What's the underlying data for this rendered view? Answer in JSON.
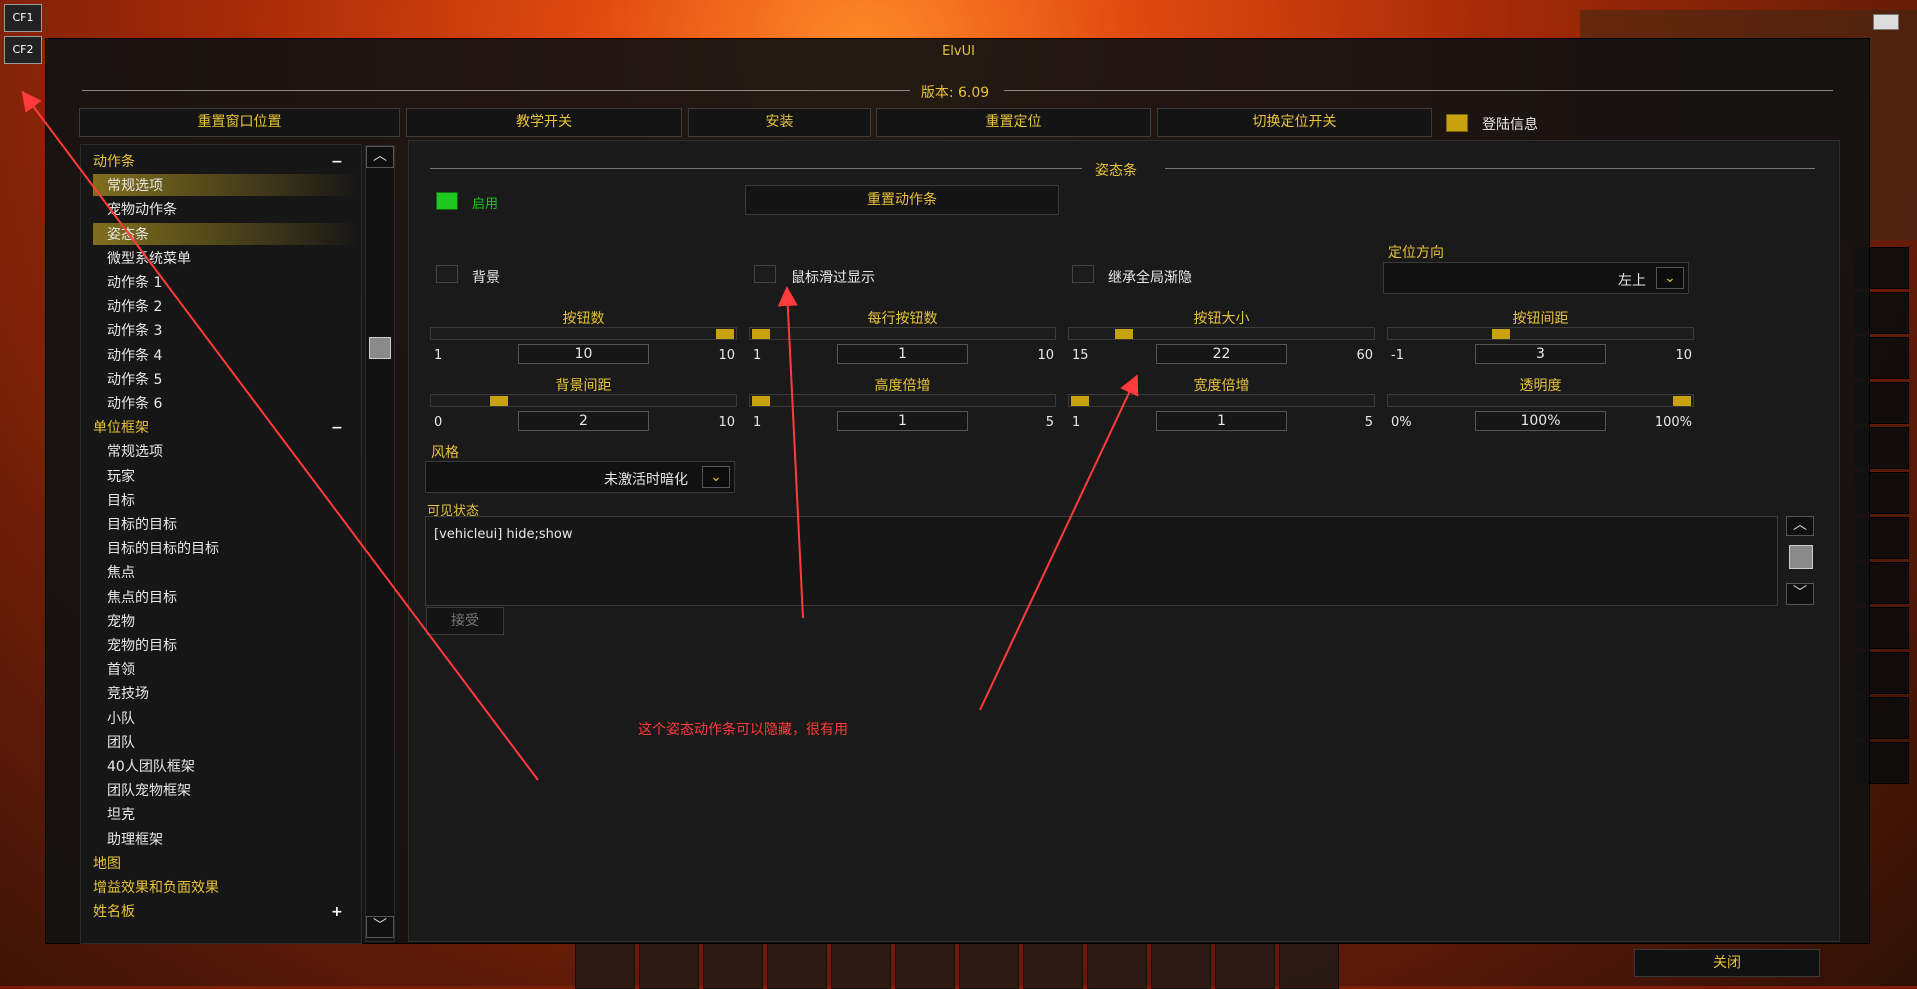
{
  "window_title": "ElvUI",
  "version_label": "版本:",
  "version_value": "6.09",
  "corner": {
    "cf1": "CF1",
    "cf2": "CF2"
  },
  "top_buttons": [
    "重置窗口位置",
    "教学开关",
    "安装",
    "重置定位",
    "切换定位开关"
  ],
  "login_info": {
    "label": "登陆信息",
    "checked": true
  },
  "sidebar": [
    {
      "label": "动作条",
      "type": "category",
      "toggle": "−"
    },
    {
      "label": "常规选项",
      "type": "item",
      "selected": true
    },
    {
      "label": "宠物动作条",
      "type": "item"
    },
    {
      "label": "姿态条",
      "type": "item",
      "selected": true
    },
    {
      "label": "微型系统菜单",
      "type": "item"
    },
    {
      "label": "动作条 1",
      "type": "item"
    },
    {
      "label": "动作条 2",
      "type": "item"
    },
    {
      "label": "动作条 3",
      "type": "item"
    },
    {
      "label": "动作条 4",
      "type": "item"
    },
    {
      "label": "动作条 5",
      "type": "item"
    },
    {
      "label": "动作条 6",
      "type": "item"
    },
    {
      "label": "单位框架",
      "type": "category",
      "toggle": "−"
    },
    {
      "label": "常规选项",
      "type": "item"
    },
    {
      "label": "玩家",
      "type": "item"
    },
    {
      "label": "目标",
      "type": "item"
    },
    {
      "label": "目标的目标",
      "type": "item"
    },
    {
      "label": "目标的目标的目标",
      "type": "item"
    },
    {
      "label": "焦点",
      "type": "item"
    },
    {
      "label": "焦点的目标",
      "type": "item"
    },
    {
      "label": "宠物",
      "type": "item"
    },
    {
      "label": "宠物的目标",
      "type": "item"
    },
    {
      "label": "首领",
      "type": "item"
    },
    {
      "label": "竞技场",
      "type": "item"
    },
    {
      "label": "小队",
      "type": "item"
    },
    {
      "label": "团队",
      "type": "item"
    },
    {
      "label": "40人团队框架",
      "type": "item"
    },
    {
      "label": "团队宠物框架",
      "type": "item"
    },
    {
      "label": "坦克",
      "type": "item"
    },
    {
      "label": "助理框架",
      "type": "item"
    },
    {
      "label": "地图",
      "type": "category"
    },
    {
      "label": "增益效果和负面效果",
      "type": "category"
    },
    {
      "label": "姓名板",
      "type": "category",
      "toggle": "+"
    }
  ],
  "scroll_up": "︿",
  "scroll_down": "﹀",
  "panel": {
    "header": "姿态条",
    "enable_label": "启用",
    "reset_button": "重置动作条",
    "backdrop_label": "背景",
    "mouseover_label": "鼠标滑过显示",
    "inherit_fade_label": "继承全局渐隐",
    "anchor": {
      "label": "定位方向",
      "value": "左上"
    },
    "sliders": [
      {
        "label": "按钮数",
        "min": "1",
        "max": "10",
        "value": "10",
        "fraction": 1.0
      },
      {
        "label": "每行按钮数",
        "min": "1",
        "max": "10",
        "value": "1",
        "fraction": 0.0
      },
      {
        "label": "按钮大小",
        "min": "15",
        "max": "60",
        "value": "22",
        "fraction": 0.155
      },
      {
        "label": "按钮间距",
        "min": "-1",
        "max": "10",
        "value": "3",
        "fraction": 0.36
      },
      {
        "label": "背景间距",
        "min": "0",
        "max": "10",
        "value": "2",
        "fraction": 0.2
      },
      {
        "label": "高度倍增",
        "min": "1",
        "max": "5",
        "value": "1",
        "fraction": 0.0
      },
      {
        "label": "宽度倍增",
        "min": "1",
        "max": "5",
        "value": "1",
        "fraction": 0.0
      },
      {
        "label": "透明度",
        "min": "0%",
        "max": "100%",
        "value": "100%",
        "fraction": 1.0
      }
    ],
    "style": {
      "label": "风格",
      "value": "未激活时暗化"
    },
    "visibility": {
      "label": "可见状态",
      "value": "[vehicleui] hide;show"
    },
    "accept_button": "接受"
  },
  "annotation": "这个姿态动作条可以隐藏，很有用",
  "close_button": "关闭",
  "colors": {
    "accent": "#e8c23a",
    "check_gold": "#c9a210",
    "check_green": "#1ec81e",
    "annotation": "#ff3b3b"
  },
  "dd_icon": "chevron-down-icon"
}
